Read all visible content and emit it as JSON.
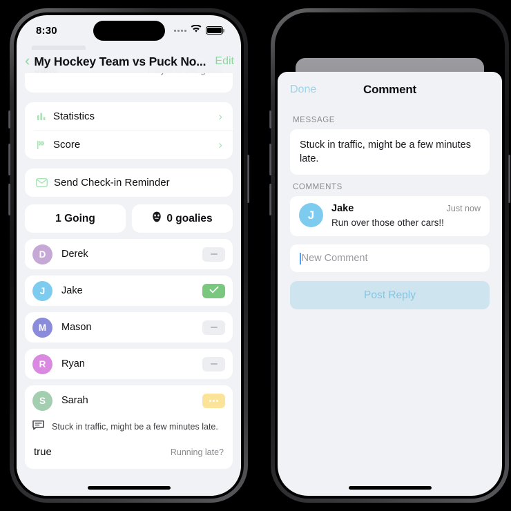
{
  "left_phone": {
    "status_bar": {
      "time": "8:30",
      "wifi_icon": "wifi-icon",
      "battery_icon": "battery-icon",
      "signal_icon": "signal-dots-icon"
    },
    "nav": {
      "back_icon": "chevron-left-icon",
      "title": "My Hockey Team vs Puck No...",
      "edit_label": "Edit"
    },
    "player_of_the_game": {
      "name": "Jake",
      "label": "Player of the game"
    },
    "menu_items": [
      {
        "label": "Statistics",
        "icon": "bar-chart-icon",
        "chevron": "chevron-right-icon"
      },
      {
        "label": "Score",
        "icon": "checkered-flag-icon",
        "chevron": "chevron-right-icon"
      }
    ],
    "reminder": {
      "label": "Send Check-in Reminder",
      "icon": "envelope-icon"
    },
    "segments": [
      {
        "label": "1 Going",
        "icon": ""
      },
      {
        "label": "0 goalies",
        "icon": "goalie-mask-icon"
      }
    ],
    "players": [
      {
        "initial": "D",
        "name": "Derek",
        "avatar_color": "#c6a8d6",
        "status": "none"
      },
      {
        "initial": "J",
        "name": "Jake",
        "avatar_color": "#7ecbf0",
        "status": "yes"
      },
      {
        "initial": "M",
        "name": "Mason",
        "avatar_color": "#8b8bdb",
        "status": "none"
      },
      {
        "initial": "R",
        "name": "Ryan",
        "avatar_color": "#d98ae0",
        "status": "none"
      },
      {
        "initial": "S",
        "name": "Sarah",
        "avatar_color": "#a3ceb0",
        "status": "maybe"
      }
    ],
    "sarah_detail": {
      "comment_icon": "comment-bubble-icon",
      "comment_text": "Stuck in traffic, might be a few minutes late.",
      "running_late_value": "true",
      "running_late_label": "Running late?"
    }
  },
  "right_phone": {
    "sheet": {
      "done_label": "Done",
      "title": "Comment",
      "message_section_label": "MESSAGE",
      "message_text": "Stuck in traffic, might be a few minutes late.",
      "comments_section_label": "COMMENTS",
      "comments": [
        {
          "initial": "J",
          "name": "Jake",
          "time": "Just now",
          "text": "Run over those other cars!!",
          "avatar_color": "#7ecbf0"
        }
      ],
      "new_comment_placeholder": "New Comment",
      "new_comment_value": "",
      "post_button_label": "Post Reply"
    }
  },
  "colors": {
    "accent_green": "#8ed79f",
    "check_green": "#7ac87f",
    "maybe_yellow": "#fbe39a",
    "sheet_blue": "#9ad3ea",
    "post_bg": "#cee5f0",
    "screen_bg": "#f1f2f6"
  }
}
